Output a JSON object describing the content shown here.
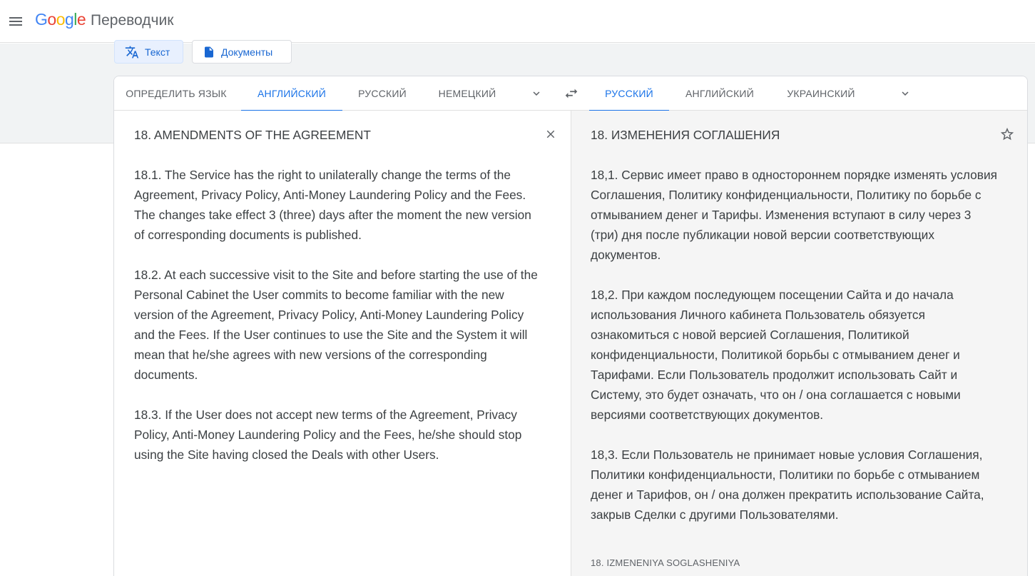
{
  "header": {
    "logo_parts": [
      "G",
      "o",
      "o",
      "g",
      "l",
      "e"
    ],
    "product_name": "Переводчик"
  },
  "modes": {
    "text_label": "Текст",
    "documents_label": "Документы"
  },
  "source_langs": {
    "detect": "ОПРЕДЕЛИТЬ ЯЗЫК",
    "items": [
      "АНГЛИЙСКИЙ",
      "РУССКИЙ",
      "НЕМЕЦКИЙ"
    ],
    "active": "АНГЛИЙСКИЙ"
  },
  "target_langs": {
    "items": [
      "РУССКИЙ",
      "АНГЛИЙСКИЙ",
      "УКРАИНСКИЙ"
    ],
    "active": "РУССКИЙ"
  },
  "source_text": "18. AMENDMENTS OF THE AGREEMENT\n\n18.1. The Service has the right to unilaterally change the terms of the Agreement, Privacy Policy, Anti-Money Laundering Policy and the Fees. The changes take effect 3 (three) days after the moment the new version of corresponding documents is published.\n\n18.2. At each successive visit to the Site and before starting the use of the Personal Cabinet the User commits to become familiar with the new version of the Agreement, Privacy Policy, Anti-Money Laundering Policy and the Fees. If the User continues to use the Site and the System it will mean that he/she agrees with new versions of the corresponding documents.\n\n18.3. If the User does not accept new terms of the Agreement, Privacy Policy, Anti-Money Laundering Policy and the Fees, he/she should stop using the Site having closed the Deals with other Users.",
  "target_text": "18. ИЗМЕНЕНИЯ СОГЛАШЕНИЯ\n\n18,1. Сервис имеет право в одностороннем порядке изменять условия Соглашения, Политику конфиденциальности, Политику по борьбе с отмыванием денег и Тарифы. Изменения вступают в силу через 3 (три) дня после публикации новой версии соответствующих документов.\n\n18,2. При каждом последующем посещении Сайта и до начала использования Личного кабинета Пользователь обязуется ознакомиться с новой версией Соглашения, Политикой конфиденциальности, Политикой борьбы с отмыванием денег и Тарифами. Если Пользователь продолжит использовать Сайт и Систему, это будет означать, что он / она соглашается с новыми версиями соответствующих документов.\n\n18,3. Если Пользователь не принимает новые условия Соглашения, Политики конфиденциальности, Политики по борьбе с отмыванием денег и Тарифов, он / она должен прекратить использование Сайта, закрыв Сделки с другими Пользователями.",
  "transliteration": "18. IZMENENIYA SOGLASHENIYA",
  "icons": [
    "menu-icon",
    "translate-icon",
    "document-icon",
    "chevron-down-icon",
    "swap-icon",
    "close-icon",
    "star-icon"
  ],
  "colors": {
    "accent": "#1a73e8",
    "target_bg": "#f5f5f5",
    "band_bg": "#f1f3f4"
  }
}
